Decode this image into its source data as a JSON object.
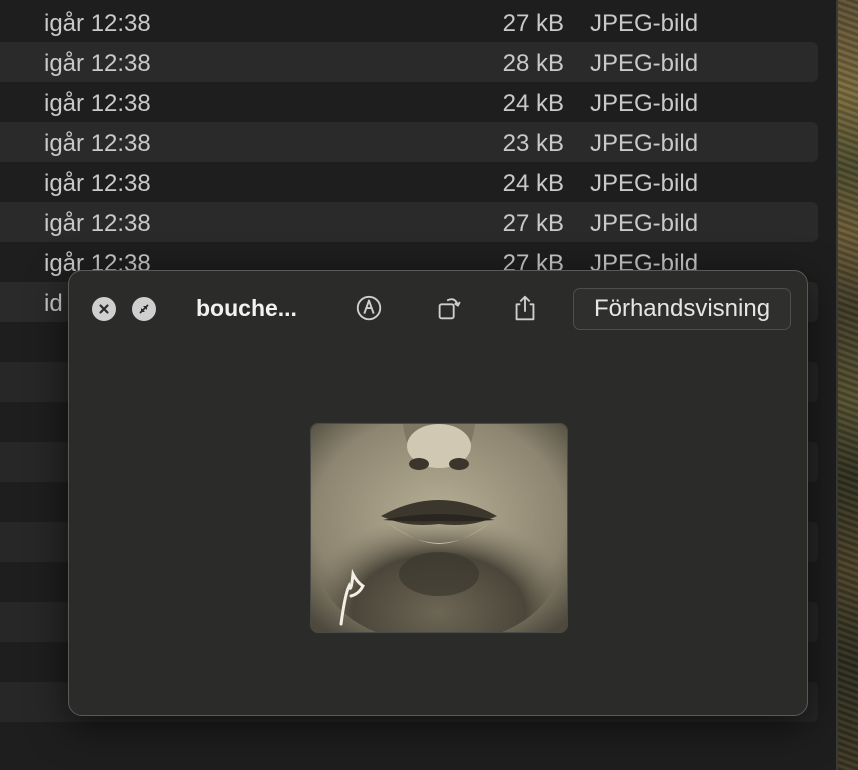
{
  "file_rows": [
    {
      "date": "igår 12:38",
      "size": "27 kB",
      "kind": "JPEG-bild"
    },
    {
      "date": "igår 12:38",
      "size": "28 kB",
      "kind": "JPEG-bild"
    },
    {
      "date": "igår 12:38",
      "size": "24 kB",
      "kind": "JPEG-bild"
    },
    {
      "date": "igår 12:38",
      "size": "23 kB",
      "kind": "JPEG-bild"
    },
    {
      "date": "igår 12:38",
      "size": "24 kB",
      "kind": "JPEG-bild"
    },
    {
      "date": "igår 12:38",
      "size": "27 kB",
      "kind": "JPEG-bild"
    },
    {
      "date": "igår 12:38",
      "size": "27 kB",
      "kind": "JPEG-bild"
    }
  ],
  "partial_row_text": "id",
  "quicklook": {
    "title": "bouche...",
    "open_with_label": "Förhandsvisning",
    "toolbar_icons": [
      "close-icon",
      "fullscreen-icon",
      "markup-icon",
      "rotate-icon",
      "share-icon"
    ]
  },
  "colors": {
    "background": "#1e1e1e",
    "row_alt": "#2a2a2a",
    "panel": "#2b2b29",
    "text": "#c9c9c9"
  }
}
